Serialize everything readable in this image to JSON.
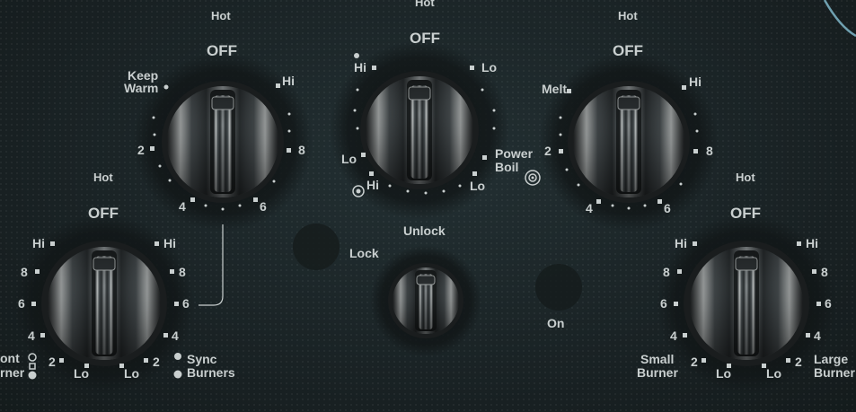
{
  "colors": {
    "panel": "#1c2527",
    "label": "#c9cfcf",
    "knob_dark": "#1a1d1e",
    "knob_light": "#d8dcdc",
    "accent_ring": "#6fa0b0"
  },
  "knobs": {
    "top_left": {
      "off": "OFF",
      "hot": "Hot",
      "keep": "Keep",
      "warm": "Warm",
      "hi": "Hi",
      "v8": "8",
      "v6": "6",
      "v4": "4",
      "v2": "2"
    },
    "center": {
      "off": "OFF",
      "hot": "Hot",
      "hi_left": "Hi",
      "lo_right": "Lo",
      "lo_left": "Lo",
      "hi_bottom": "Hi",
      "lo_bottom": "Lo",
      "power": "Power",
      "boil": "Boil"
    },
    "top_right": {
      "off": "OFF",
      "hot": "Hot",
      "melt": "Melt",
      "hi": "Hi",
      "v8": "8",
      "v6": "6",
      "v4": "4",
      "v2": "2"
    },
    "bottom_left": {
      "off": "OFF",
      "hot": "Hot",
      "hi_l": "Hi",
      "hi_r": "Hi",
      "v8_l": "8",
      "v8_r": "8",
      "v6_l": "6",
      "v6_r": "6",
      "v4_l": "4",
      "v4_r": "4",
      "v2_l": "2",
      "v2_r": "2",
      "lo_l": "Lo",
      "lo_r": "Lo",
      "front": "ont",
      "burner": "rner",
      "sync": "Sync",
      "burners": "Burners"
    },
    "bottom_right": {
      "off": "OFF",
      "hot": "Hot",
      "hi_l": "Hi",
      "hi_r": "Hi",
      "v8_l": "8",
      "v8_r": "8",
      "v6_l": "6",
      "v6_r": "6",
      "v4_l": "4",
      "v4_r": "4",
      "v2_l": "2",
      "v2_r": "2",
      "lo_l": "Lo",
      "lo_r": "Lo",
      "small": "Small",
      "small_burner": "Burner",
      "large": "Large",
      "large_burner": "Burner"
    }
  },
  "lock": {
    "unlock": "Unlock",
    "lock": "Lock",
    "on": "On"
  }
}
